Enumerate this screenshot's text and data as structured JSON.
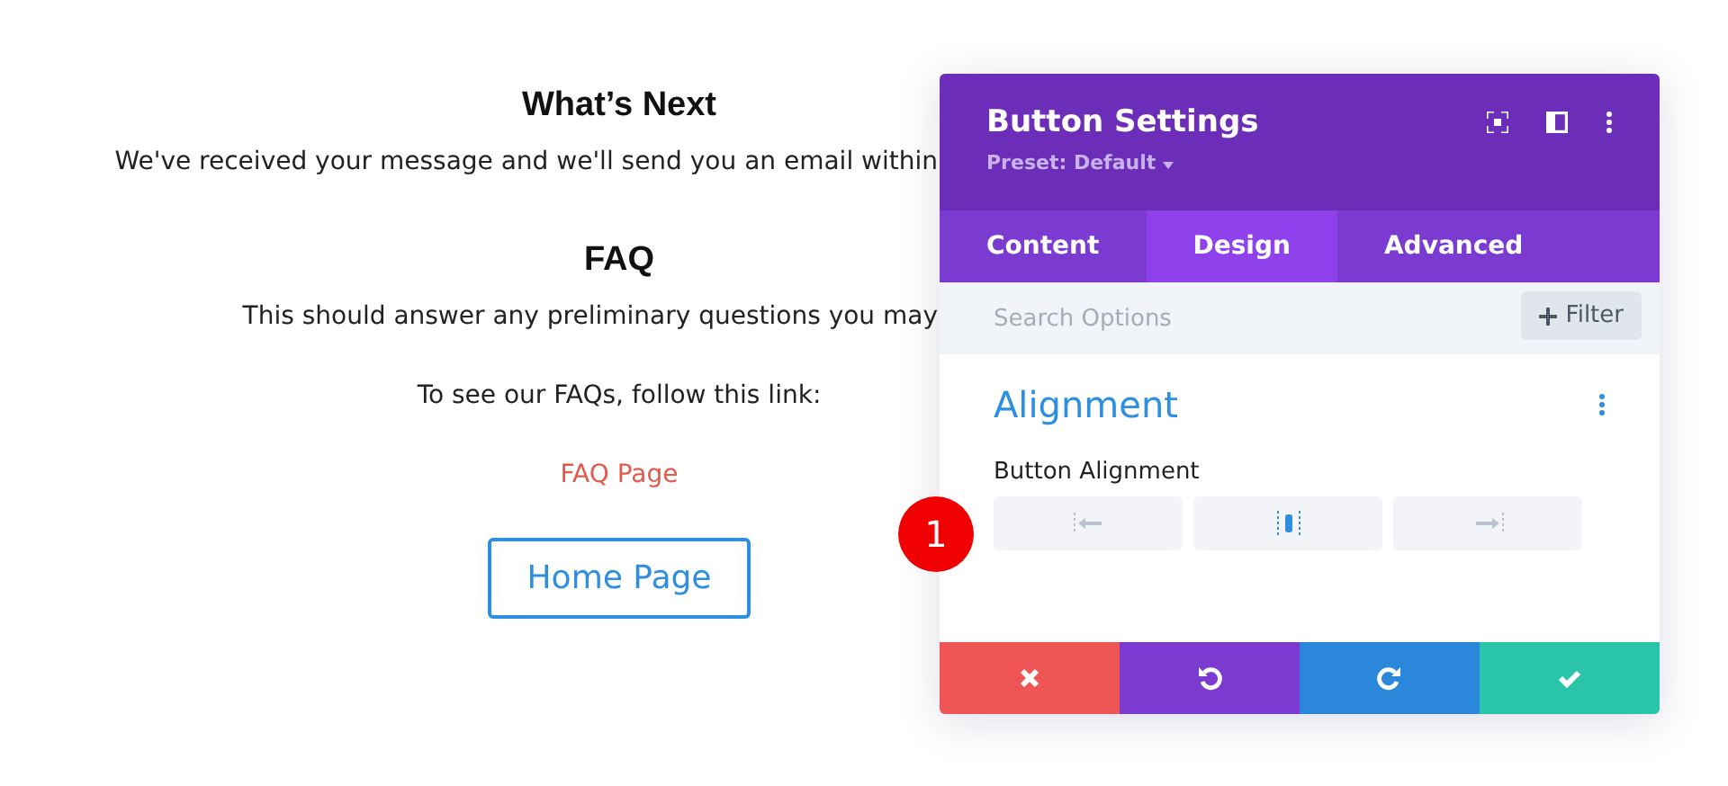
{
  "page": {
    "blocks": [
      {
        "kind": "heading",
        "text": "What’s Next"
      },
      {
        "kind": "cut-text",
        "text": "We've received your message and we'll send you an email within"
      },
      {
        "kind": "heading",
        "text": "FAQ"
      },
      {
        "kind": "cut-text",
        "text": "This should answer any preliminary questions you may"
      },
      {
        "kind": "text",
        "text": "To see our FAQs, follow this link:"
      },
      {
        "kind": "link",
        "text": "FAQ Page"
      },
      {
        "kind": "button",
        "text": "Home Page"
      }
    ]
  },
  "step_badge": "1",
  "panel": {
    "title": "Button Settings",
    "preset": "Preset: Default",
    "tabs": [
      {
        "label": "Content",
        "selected": false
      },
      {
        "label": "Design",
        "selected": true
      },
      {
        "label": "Advanced",
        "selected": false
      }
    ],
    "search": {
      "placeholder": "Search Options"
    },
    "filter_button": "Filter",
    "section": {
      "title": "Alignment",
      "field_label": "Button Alignment",
      "options": [
        {
          "kind": "left",
          "selected": false
        },
        {
          "kind": "center",
          "selected": true
        },
        {
          "kind": "right",
          "selected": false
        }
      ]
    },
    "actions": [
      {
        "kind": "cancel"
      },
      {
        "kind": "undo"
      },
      {
        "kind": "redo"
      },
      {
        "kind": "save"
      }
    ]
  }
}
